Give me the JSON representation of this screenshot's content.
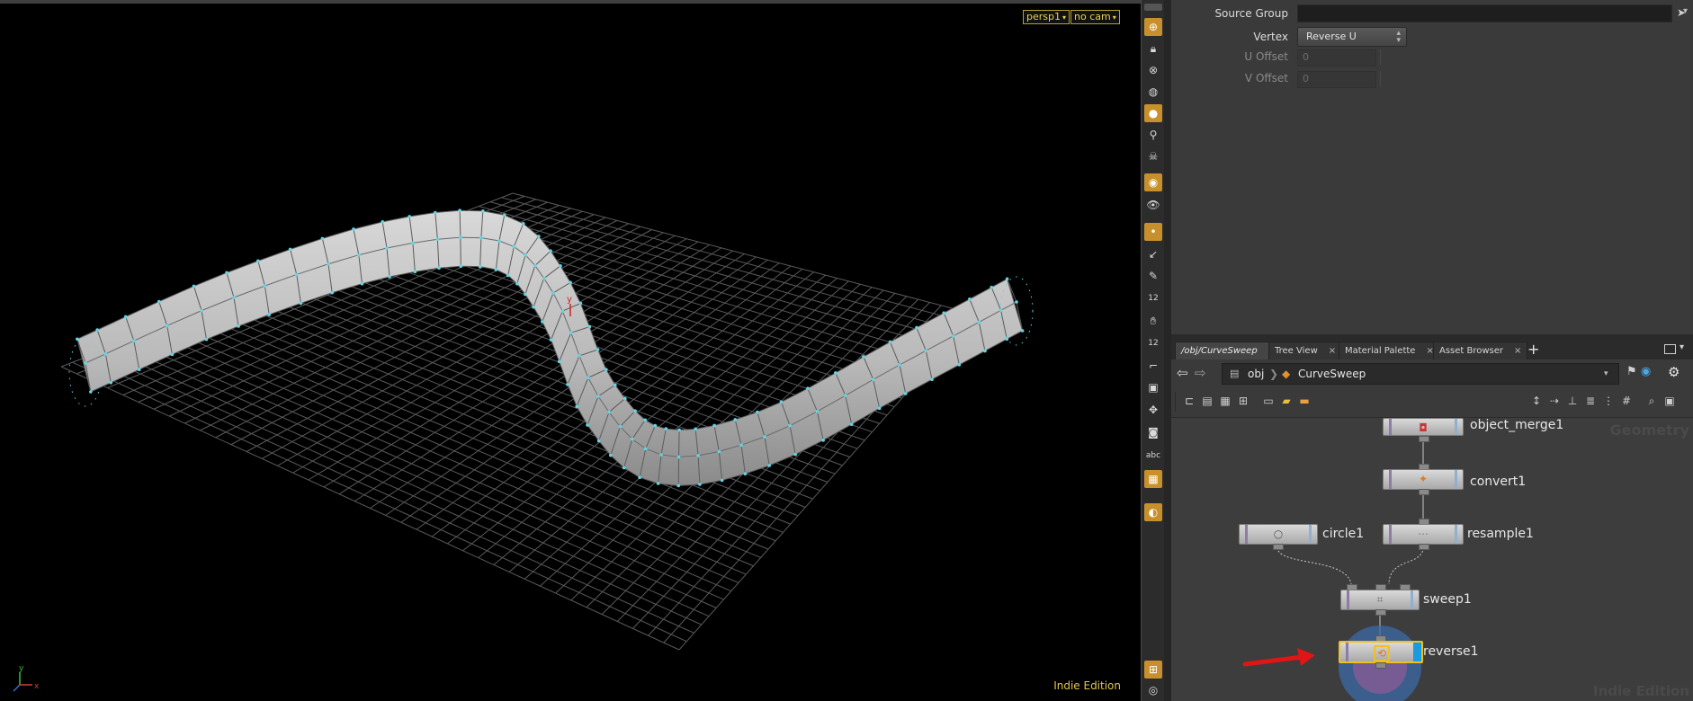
{
  "viewport": {
    "camera_menu": "persp1",
    "cam_menu": "no cam",
    "edition_badge": "Indie Edition",
    "axis_labels": {
      "x": "x",
      "y": "y"
    },
    "handle_label": "y"
  },
  "vp_toolbar": {
    "text_tool_label": "abc",
    "point_numbers_label": "12",
    "primitive_numbers_label": "12"
  },
  "parameters": {
    "source_group": {
      "label": "Source Group",
      "value": ""
    },
    "vertex": {
      "label": "Vertex",
      "value": "Reverse U"
    },
    "u_offset": {
      "label": "U Offset",
      "value": "0"
    },
    "v_offset": {
      "label": "V Offset",
      "value": "0"
    }
  },
  "tabs": [
    {
      "label": "/obj/CurveSweep",
      "close": "×"
    },
    {
      "label": "Tree View",
      "close": "×"
    },
    {
      "label": "Material Palette",
      "close": "×"
    },
    {
      "label": "Asset Browser",
      "close": "×"
    }
  ],
  "add_tab": "+",
  "path": {
    "root": "obj",
    "current": "CurveSweep"
  },
  "network": {
    "context_watermark": "Geometry",
    "edition_watermark": "Indie Edition",
    "nodes": [
      {
        "name": "object_merge1"
      },
      {
        "name": "convert1"
      },
      {
        "name": "circle1"
      },
      {
        "name": "resample1"
      },
      {
        "name": "sweep1"
      },
      {
        "name": "reverse1"
      }
    ]
  },
  "colors": {
    "accent_orange": "#c8902c",
    "viewport_badge": "#e8d24a",
    "node_selected": "#f0c020",
    "display_flag": "#1a9be0",
    "arrow": "#e01515"
  }
}
